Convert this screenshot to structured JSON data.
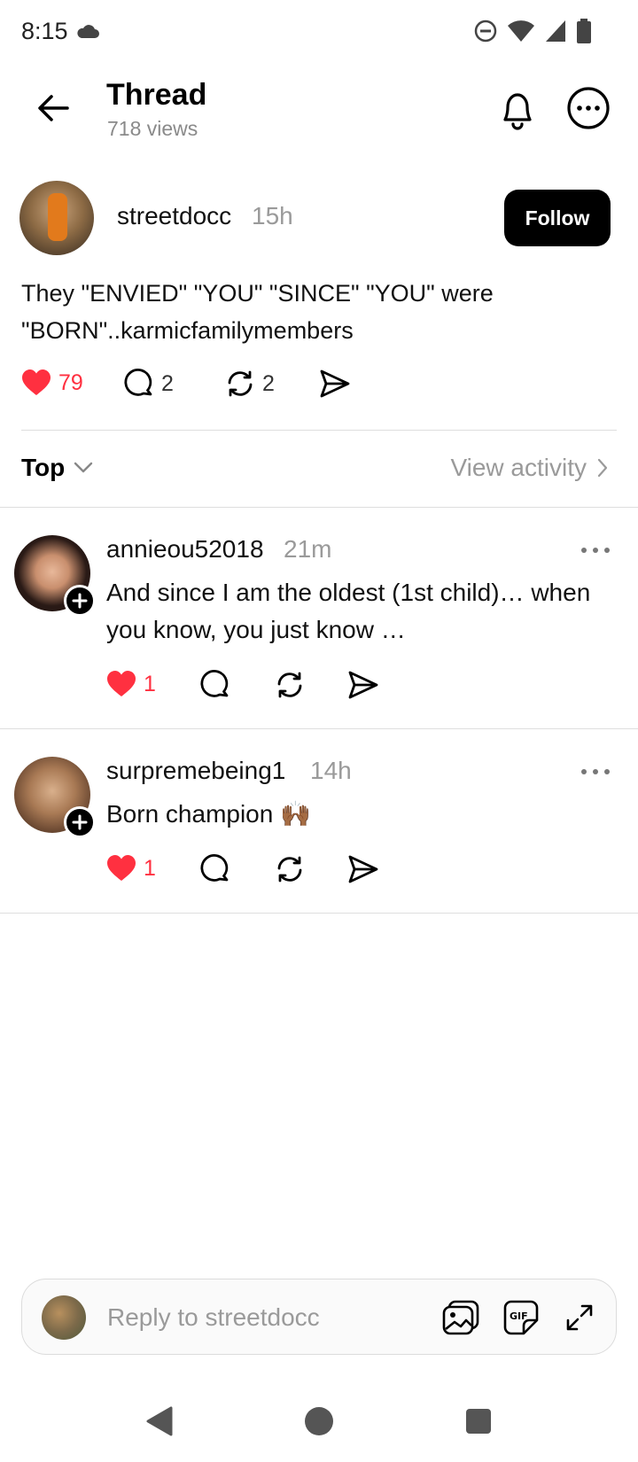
{
  "status_bar": {
    "time": "8:15"
  },
  "header": {
    "title": "Thread",
    "views": "718 views"
  },
  "post": {
    "username": "streetdocc",
    "time": "15h",
    "follow_label": "Follow",
    "text": "They \"ENVIED\" \"YOU\" \"SINCE\" \"YOU\" were \"BORN\"..karmicfamilymembers",
    "likes": "79",
    "comments": "2",
    "reposts": "2"
  },
  "sort": {
    "label": "Top",
    "view_activity": "View activity"
  },
  "replies": [
    {
      "username": "annieou52018",
      "time": "21m",
      "text": "And since I am the oldest (1st child)… when you know, you just know …",
      "likes": "1"
    },
    {
      "username": "surpremebeing1",
      "time": "14h",
      "text": "Born champion 🙌🏾",
      "likes": "1"
    }
  ],
  "reply_box": {
    "placeholder": "Reply to streetdocc"
  },
  "colors": {
    "like": "#ff3040",
    "muted": "#9a9a9a",
    "follow_bg": "#000000"
  }
}
